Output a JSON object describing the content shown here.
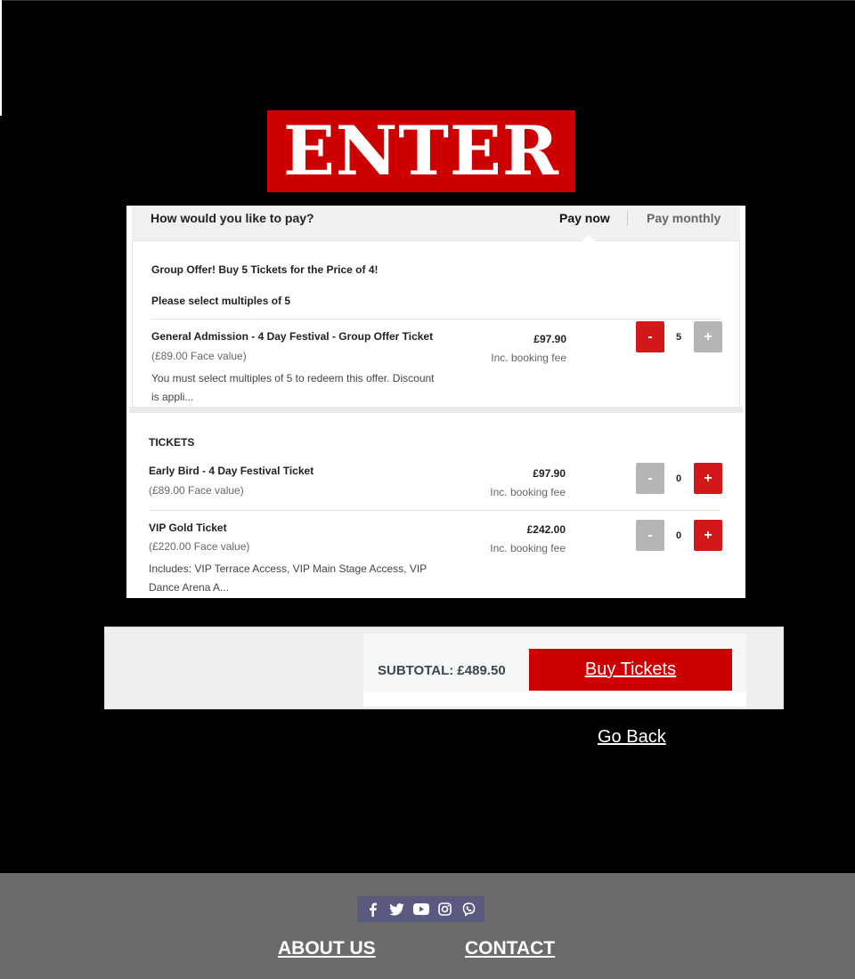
{
  "logo": {
    "text": "ENTER"
  },
  "payment": {
    "question": "How would you like to pay?",
    "pay_now": "Pay now",
    "pay_monthly": "Pay monthly"
  },
  "group_offer": {
    "title": "Group Offer! Buy 5 Tickets for the Price of 4!",
    "note": "Please select multiples of 5",
    "ticket": {
      "name": "General Admission - 4 Day Festival - Group Offer Ticket",
      "face_value": "(£89.00 Face value)",
      "description_line1": "You must select multiples of 5 to redeem this offer. Discount",
      "description_line2": "is appli...",
      "price": "£97.90",
      "fee": "Inc. booking fee",
      "minus": "-",
      "quantity": "5",
      "plus": "+"
    }
  },
  "tickets": {
    "heading": "TICKETS",
    "items": [
      {
        "name": "Early Bird - 4 Day Festival Ticket",
        "face_value": "(£89.00 Face value)",
        "price": "£97.90",
        "fee": "Inc. booking fee",
        "minus": "-",
        "quantity": "0",
        "plus": "+"
      },
      {
        "name": "VIP Gold Ticket",
        "face_value": "(£220.00 Face value)",
        "description_line1": "Includes: VIP Terrace Access, VIP Main Stage Access, VIP",
        "description_line2": "Dance Arena A...",
        "price": "£242.00",
        "fee": "Inc. booking fee",
        "minus": "-",
        "quantity": "0",
        "plus": "+"
      }
    ]
  },
  "checkout": {
    "subtotal": "SUBTOTAL: £489.50",
    "buy_label": "Buy Tickets"
  },
  "go_back": "Go Back",
  "footer": {
    "social_icons": [
      "facebook-icon",
      "twitter-icon",
      "youtube-icon",
      "instagram-icon",
      "viber-icon"
    ],
    "about": "ABOUT US",
    "contact": "CONTACT"
  },
  "colors": {
    "brand_red": "#cc0000",
    "button_red": "#d21818",
    "button_gray": "#b5b5b5",
    "footer_gray": "#6b6b6b",
    "social_bg": "#5a5a80"
  }
}
